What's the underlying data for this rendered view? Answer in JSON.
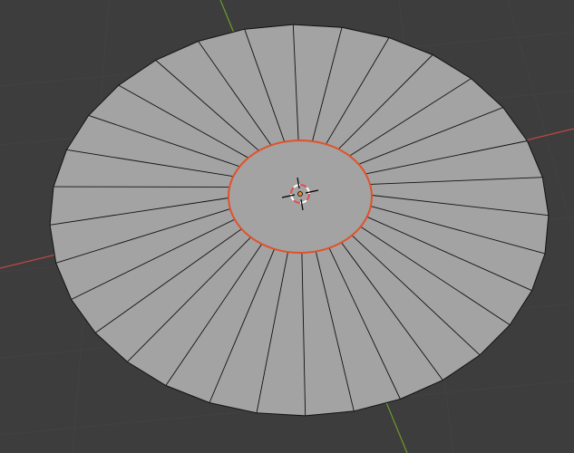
{
  "viewport": {
    "background_color": "#3d3d3d",
    "grid_color": "#474747",
    "grid_subtle_color": "#424242",
    "x_axis_color": "#c04646",
    "y_axis_color": "#6d9a2a"
  },
  "mesh": {
    "type": "circle",
    "face_color": "#a3a3a3",
    "edge_color": "#121212",
    "outer_vertex_count": 32,
    "inner_vertex_count": 32,
    "selected_edge_loop": "inner",
    "selection_color": "#e0522a"
  },
  "cursor_3d": {
    "icon": "3d-cursor-icon",
    "ring_color_a": "#e05050",
    "ring_color_b": "#ffffff",
    "crosshair_color": "#000000"
  },
  "object_origin": {
    "icon": "origin-dot-icon",
    "color": "#e88a2a"
  }
}
